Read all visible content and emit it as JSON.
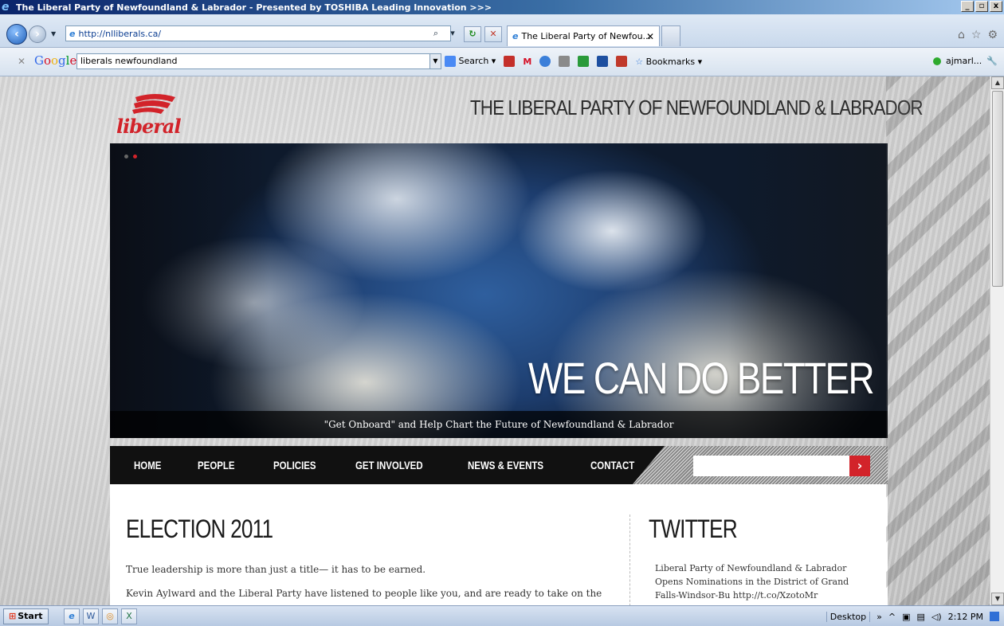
{
  "window": {
    "title": "The Liberal Party of Newfoundland & Labrador - Presented by TOSHIBA Leading Innovation >>>",
    "min_btn": "_",
    "max_btn": "▫",
    "close_btn": "x"
  },
  "addressbar": {
    "url": "http://nlliberals.ca/",
    "tab_title": "The Liberal Party of Newfou...",
    "tab_close": "✕"
  },
  "google_toolbar": {
    "query": "liberals newfoundland",
    "search_label": "Search",
    "bookmarks_label": "Bookmarks",
    "user_label": "ajmarl..."
  },
  "site": {
    "logo_text": "liberal",
    "title": "THE LIBERAL PARTY OF NEWFOUNDLAND & LABRADOR",
    "hero_headline": "WE CAN DO BETTER",
    "hero_caption": "\"Get Onboard\" and Help Chart the Future of Newfoundland & Labrador",
    "nav": [
      "HOME",
      "PEOPLE",
      "POLICIES",
      "GET INVOLVED",
      "NEWS & EVENTS",
      "CONTACT"
    ],
    "search_btn": "›"
  },
  "content": {
    "main_heading": "ELECTION 2011",
    "para1": "True leadership is more than just a title— it has to be earned.",
    "para2": "Kevin Aylward and the Liberal Party have listened to people like you, and are ready to take on the",
    "side_heading": "TWITTER",
    "tweet": "Liberal Party of Newfoundland & Labrador Opens Nominations in the District of Grand Falls-Windsor-Bu http://t.co/XzotoMr"
  },
  "taskbar": {
    "start_label": "Start",
    "desktop_label": "Desktop",
    "clock": "2:12 PM"
  },
  "colors": {
    "brand_red": "#d2232a",
    "nav_black": "#111111"
  }
}
